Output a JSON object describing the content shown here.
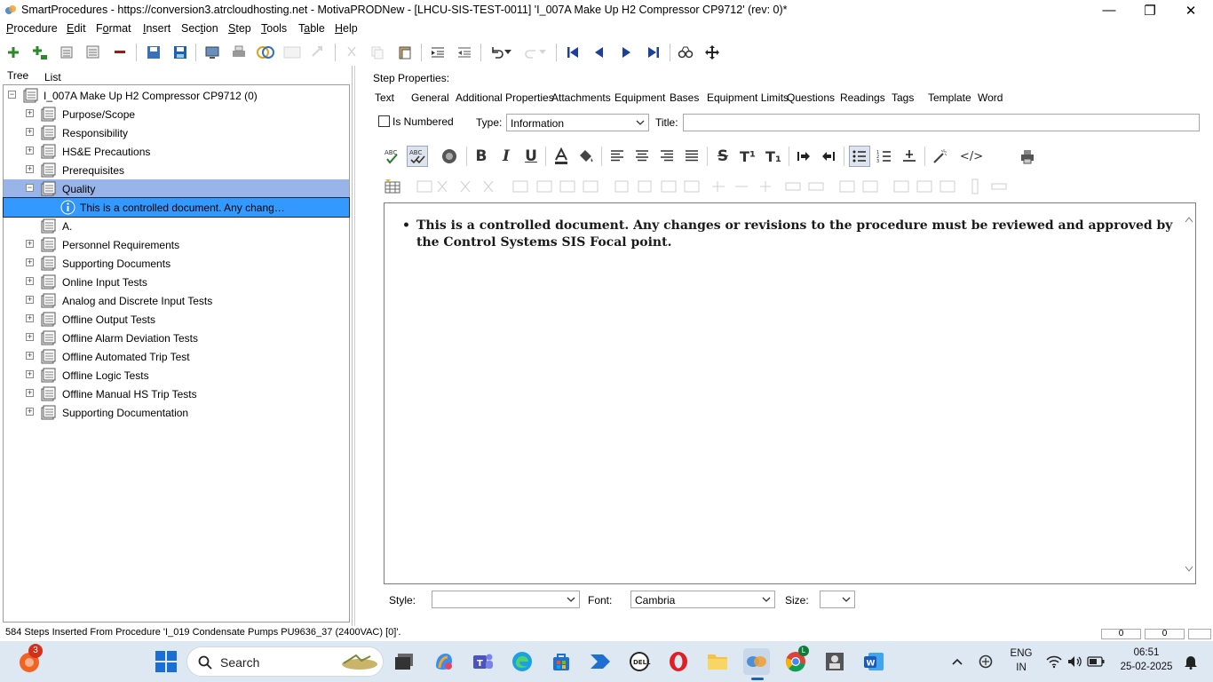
{
  "window": {
    "title": "SmartProcedures - https://conversion3.atrcloudhosting.net - MotivaPRODNew - [LHCU-SIS-TEST-0011] 'I_007A Make Up H2 Compressor CP9712' (rev: 0)*",
    "minimize": "—",
    "maximize": "❐",
    "close": "✕"
  },
  "menu": [
    {
      "pre": "",
      "u": "P",
      "post": "rocedure"
    },
    {
      "pre": "",
      "u": "E",
      "post": "dit"
    },
    {
      "pre": "F",
      "u": "o",
      "post": "rmat"
    },
    {
      "pre": "",
      "u": "I",
      "post": "nsert"
    },
    {
      "pre": "Sec",
      "u": "t",
      "post": "ion"
    },
    {
      "pre": "",
      "u": "S",
      "post": "tep"
    },
    {
      "pre": "",
      "u": "T",
      "post": "ools"
    },
    {
      "pre": "T",
      "u": "a",
      "post": "ble"
    },
    {
      "pre": "",
      "u": "H",
      "post": "elp"
    }
  ],
  "left_tabs": [
    "Tree",
    "List"
  ],
  "tree": {
    "root": "I_007A Make Up H2 Compressor CP9712 (0)",
    "nodes": [
      "Purpose/Scope",
      "Responsibility",
      "HS&E Precautions",
      "Prerequisites",
      "Quality",
      "This is a controlled document. Any chang…",
      "A.",
      "Personnel Requirements",
      "Supporting Documents",
      "Online Input Tests",
      "Analog and Discrete Input Tests",
      "Offline Output Tests",
      "Offline Alarm Deviation Tests",
      "Offline Automated Trip Test",
      "Offline Logic Tests",
      "Offline Manual HS Trip Tests",
      "Supporting Documentation"
    ]
  },
  "step_properties": {
    "heading": "Step Properties:",
    "tabs": [
      "Text",
      "General",
      "Additional Properties",
      "Attachments",
      "Equipment",
      "Bases",
      "Equipment Limits",
      "Questions",
      "Readings",
      "Tags",
      "Template",
      "Word"
    ],
    "is_numbered_label": "Is Numbered",
    "type_label": "Type:",
    "type_value": "Information",
    "title_label": "Title:",
    "title_value": ""
  },
  "editor": {
    "text": "This is a controlled document. Any changes or revisions to the procedure must be reviewed and approved by the Control Systems SIS Focal point."
  },
  "bottom_fields": {
    "style_label": "Style:",
    "style_value": "",
    "font_label": "Font:",
    "font_value": "Cambria",
    "size_label": "Size:",
    "size_value": ""
  },
  "status": {
    "text": "584 Steps Inserted From Procedure 'I_019 Condensate Pumps PU9636_37 (2400VAC) [0]'.",
    "box1": "0",
    "box2": "0"
  },
  "taskbar": {
    "badge": "3",
    "search": "Search",
    "lang1": "ENG",
    "lang2": "IN",
    "time": "06:51",
    "date": "25-02-2025"
  },
  "colors": {
    "selected_row": "#99b4e8",
    "focus_row": "#3399ff",
    "accent_blue": "#1e5fb8",
    "info_icon": "#2b8ef0"
  }
}
